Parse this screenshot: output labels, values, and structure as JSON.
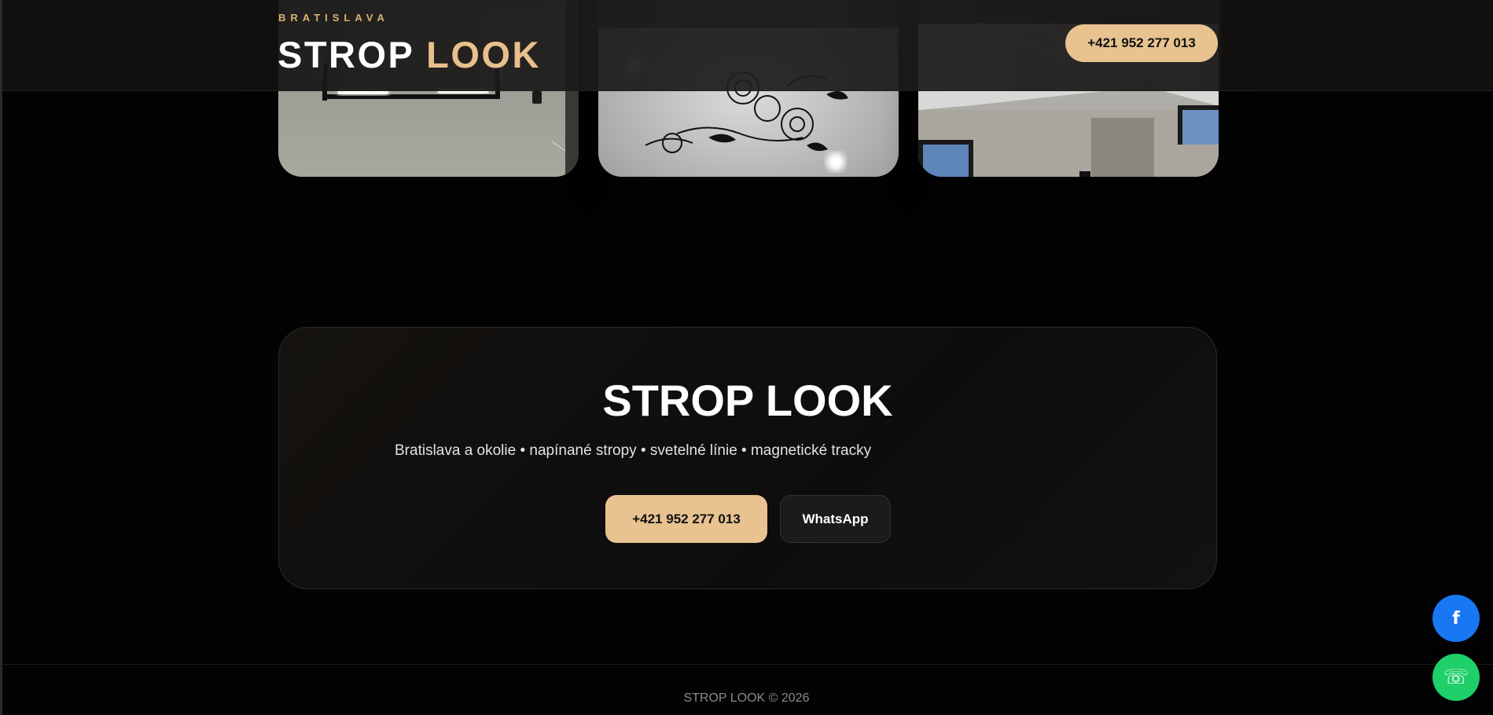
{
  "header": {
    "kicker": "BRATISLAVA",
    "brand_word1": "STROP",
    "brand_word2": "LOOK",
    "phone": "+421 952 277 013"
  },
  "gallery": {
    "photos": [
      {
        "subject": "ceiling with light lines"
      },
      {
        "subject": "ceiling with rose print"
      },
      {
        "subject": "room with light lines"
      }
    ]
  },
  "cta": {
    "title": "STROP LOOK",
    "subtitle": "Bratislava a okolie • napínané stropy • svetelné línie • magnetické tracky",
    "phone_label": "+421 952 277 013",
    "whatsapp_label": "WhatsApp"
  },
  "footer": {
    "copyright": "STROP LOOK © 2026"
  },
  "floating": {
    "facebook_glyph": "f",
    "call_glyph": "☏"
  },
  "colors": {
    "accent": "#e8c390",
    "background": "#030303",
    "facebook": "#1877f2",
    "call": "#1fcf6a"
  }
}
